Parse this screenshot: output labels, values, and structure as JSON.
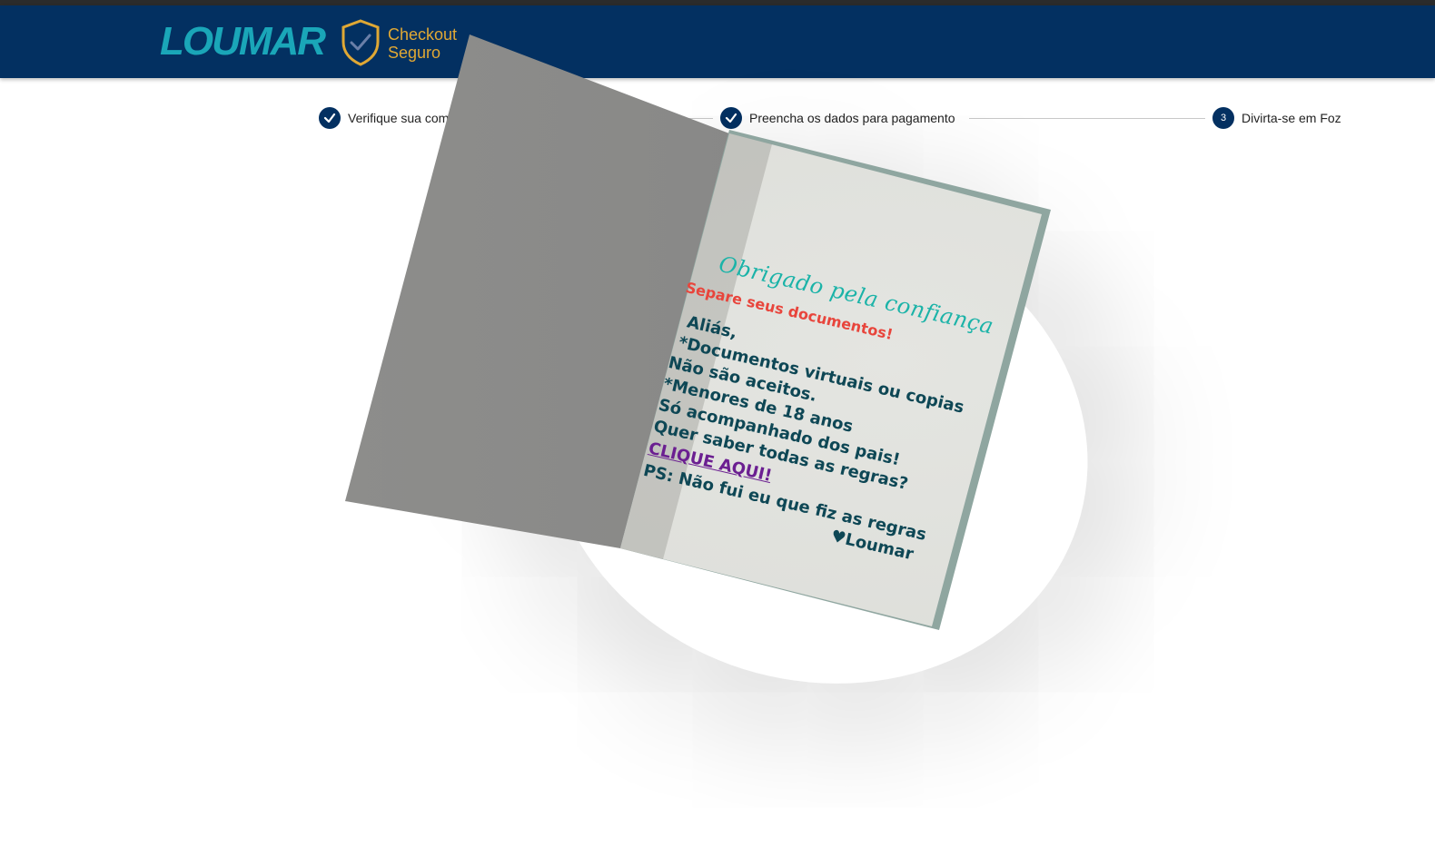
{
  "header": {
    "logo_text": "LOUMAR",
    "badge_line1": "Checkout",
    "badge_line2": "Seguro",
    "brand_color": "#033061",
    "accent_color": "#1aa6b8",
    "badge_color": "#e0a834"
  },
  "steps": [
    {
      "label": "Verifique sua com",
      "state": "done",
      "icon": "check-icon"
    },
    {
      "label": "Preencha os dados para pagamento",
      "state": "done",
      "icon": "check-icon"
    },
    {
      "label": "Divirta-se em Foz",
      "state": "current",
      "number": "3"
    }
  ],
  "card": {
    "title": "Obrigado pela confiança",
    "subtitle": "Separe seus documentos!",
    "lines": [
      "Aliás,",
      "*Documentos virtuais ou copias",
      "Não são aceitos.",
      "*Menores de 18 anos",
      "Só acompanhado dos pais!",
      "Quer saber todas as regras?"
    ],
    "link": "CLIQUE AQUI!",
    "ps": "PS: Não fui eu que fiz as regras",
    "signature": "♥Loumar"
  }
}
